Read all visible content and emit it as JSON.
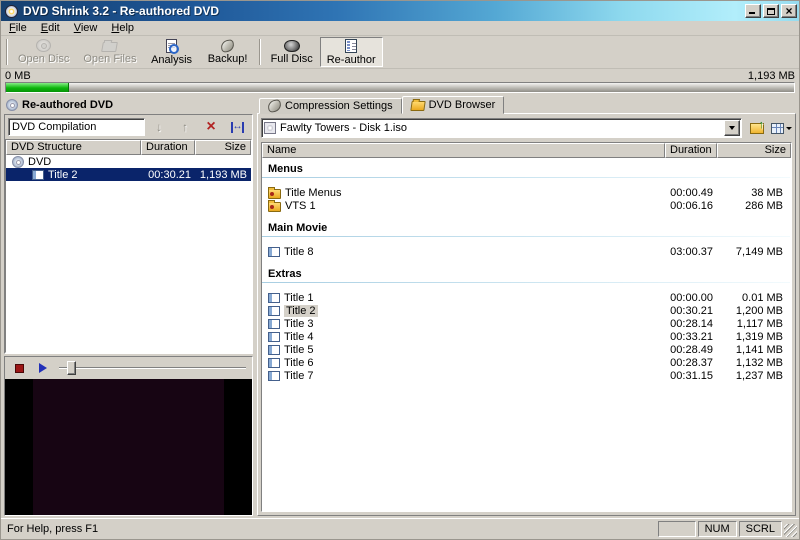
{
  "window": {
    "title": "DVD Shrink 3.2 - Re-authored DVD"
  },
  "menu": {
    "items": [
      {
        "label": "File"
      },
      {
        "label": "Edit"
      },
      {
        "label": "View"
      },
      {
        "label": "Help"
      }
    ]
  },
  "toolbar": {
    "buttons": [
      {
        "separator": true
      },
      {
        "label": "Open Disc",
        "icon": "open-disc-icon",
        "disabled": true
      },
      {
        "label": "Open Files",
        "icon": "open-files-icon",
        "disabled": true
      },
      {
        "label": "Analysis",
        "icon": "analysis-icon"
      },
      {
        "label": "Backup!",
        "icon": "backup-icon"
      },
      {
        "separator": true
      },
      {
        "label": "Full Disc",
        "icon": "full-disc-icon"
      },
      {
        "label": "Re-author",
        "icon": "re-author-icon",
        "pressed": true
      }
    ]
  },
  "capacity": {
    "used_label": "0 MB",
    "total_label": "1,193 MB",
    "fill_percent": 8
  },
  "left_panel": {
    "header": "Re-authored DVD",
    "compilation_name": "DVD Compilation",
    "buttons": [
      {
        "name": "move-down-button",
        "icon": "arrow-down-icon",
        "disabled": true
      },
      {
        "name": "move-up-button",
        "icon": "arrow-up-icon",
        "disabled": true
      },
      {
        "name": "remove-title-button",
        "icon": "red-x-icon"
      },
      {
        "name": "set-start-end-frames-button",
        "icon": "start-end-frames-icon"
      }
    ],
    "columns": [
      "DVD Structure",
      "Duration",
      "Size"
    ],
    "tree": [
      {
        "label": "DVD",
        "icon": "dvd-disc-icon",
        "level": 0,
        "duration": "",
        "size": ""
      },
      {
        "label": "Title 2",
        "icon": "title-icon",
        "level": 1,
        "duration": "00:30.21",
        "size": "1,193 MB",
        "selected": true
      }
    ]
  },
  "right_panel": {
    "tabs": [
      {
        "label": "Compression Settings",
        "icon": "shrink-icon"
      },
      {
        "label": "DVD Browser",
        "icon": "folder-open-icon",
        "active": true
      }
    ],
    "path_combo": {
      "value": "Fawlty Towers - Disk 1.iso",
      "icon": "disc-image-icon"
    },
    "browser_buttons": [
      {
        "name": "up-directory-button",
        "icon": "folder-up-icon"
      },
      {
        "name": "views-button",
        "icon": "views-icon",
        "has_dropdown": true
      }
    ],
    "columns": [
      "Name",
      "Duration",
      "Size"
    ],
    "groups": [
      {
        "name": "Menus",
        "items": [
          {
            "name": "Title Menus",
            "icon": "menu-folder-icon",
            "duration": "00:00.49",
            "size": "38 MB"
          },
          {
            "name": "VTS 1",
            "icon": "menu-folder-icon",
            "duration": "00:06.16",
            "size": "286 MB"
          }
        ]
      },
      {
        "name": "Main Movie",
        "items": [
          {
            "name": "Title 8",
            "icon": "title-icon",
            "duration": "03:00.37",
            "size": "7,149 MB"
          }
        ]
      },
      {
        "name": "Extras",
        "items": [
          {
            "name": "Title 1",
            "icon": "title-icon",
            "duration": "00:00.00",
            "size": "0.01 MB"
          },
          {
            "name": "Title 2",
            "icon": "title-icon",
            "duration": "00:30.21",
            "size": "1,200 MB",
            "selected": true
          },
          {
            "name": "Title 3",
            "icon": "title-icon",
            "duration": "00:28.14",
            "size": "1,117 MB"
          },
          {
            "name": "Title 4",
            "icon": "title-icon",
            "duration": "00:33.21",
            "size": "1,319 MB"
          },
          {
            "name": "Title 5",
            "icon": "title-icon",
            "duration": "00:28.49",
            "size": "1,141 MB"
          },
          {
            "name": "Title 6",
            "icon": "title-icon",
            "duration": "00:28.37",
            "size": "1,132 MB"
          },
          {
            "name": "Title 7",
            "icon": "title-icon",
            "duration": "00:31.15",
            "size": "1,237 MB"
          }
        ]
      }
    ]
  },
  "player": {
    "buttons": [
      {
        "name": "stop-button",
        "icon": "stop-icon"
      },
      {
        "name": "play-button",
        "icon": "play-icon"
      }
    ]
  },
  "status_bar": {
    "message": "For Help, press F1",
    "panels": [
      {
        "label": ""
      },
      {
        "label": "NUM"
      },
      {
        "label": "SCRL"
      }
    ]
  }
}
